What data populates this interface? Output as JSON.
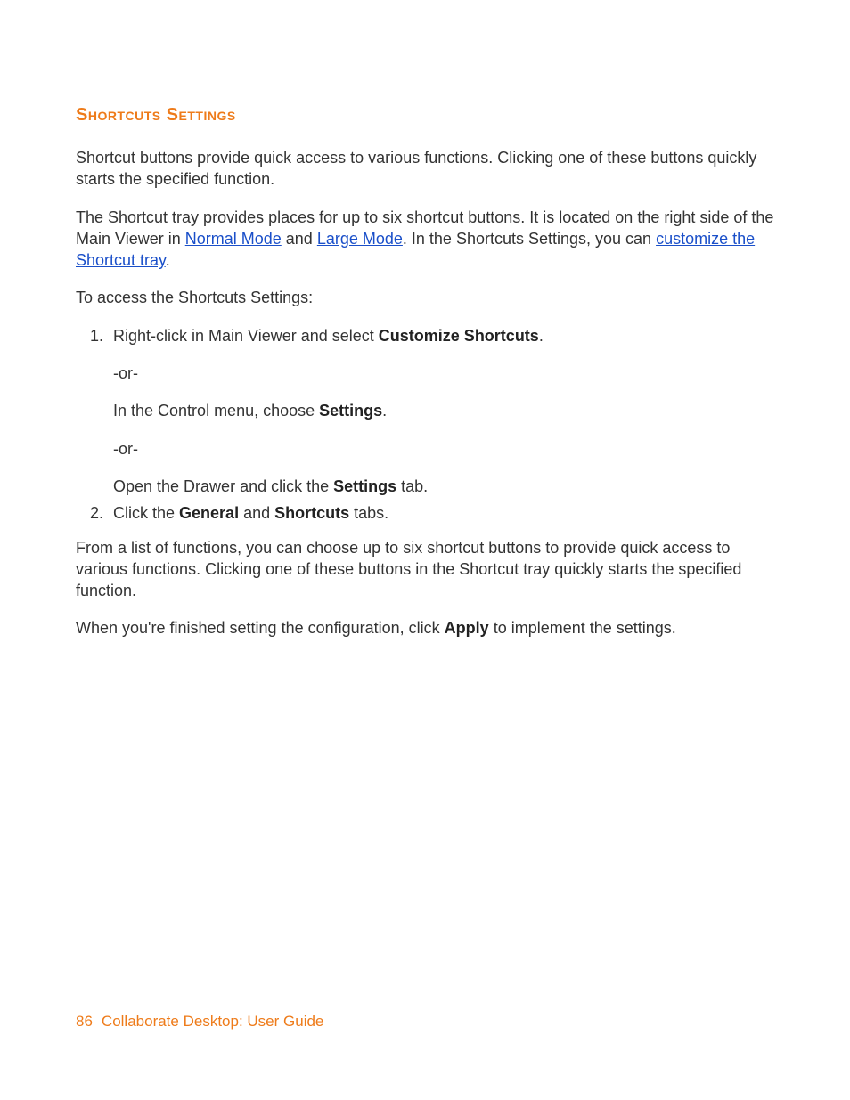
{
  "heading": "Shortcuts Settings",
  "intro1": "Shortcut buttons provide quick access to various functions. Clicking one of these buttons quickly starts the specified function.",
  "intro2a": "The Shortcut tray provides places for up to six shortcut buttons. It is located on the right side of the Main Viewer in ",
  "link_normal": "Normal Mode",
  "intro2b": " and ",
  "link_large": "Large Mode",
  "intro2c": ". In the Shortcuts Settings, you can ",
  "link_customize": "customize the Shortcut tray",
  "intro2d": ".",
  "access_line": "To access the Shortcuts Settings:",
  "step1a": "Right-click in Main Viewer and select ",
  "step1a_bold": "Customize Shortcuts",
  "step1a_end": ".",
  "or": "-or-",
  "step1b_pre": "In the Control menu, choose ",
  "step1b_bold": "Settings",
  "step1b_end": ".",
  "step1c_pre": "Open the Drawer and click the ",
  "step1c_bold": "Settings",
  "step1c_end": " tab.",
  "step2_pre": "Click the ",
  "step2_b1": "General",
  "step2_mid": " and ",
  "step2_b2": "Shortcuts",
  "step2_end": " tabs.",
  "post1": "From a list of functions, you can choose up to six shortcut buttons to provide quick access to various functions. Clicking one of these buttons in the Shortcut tray quickly starts the specified function.",
  "post2_pre": "When you're finished setting the configuration, click ",
  "post2_bold": "Apply",
  "post2_end": " to implement the settings.",
  "footer_page": "86",
  "footer_title": "Collaborate Desktop: User Guide"
}
